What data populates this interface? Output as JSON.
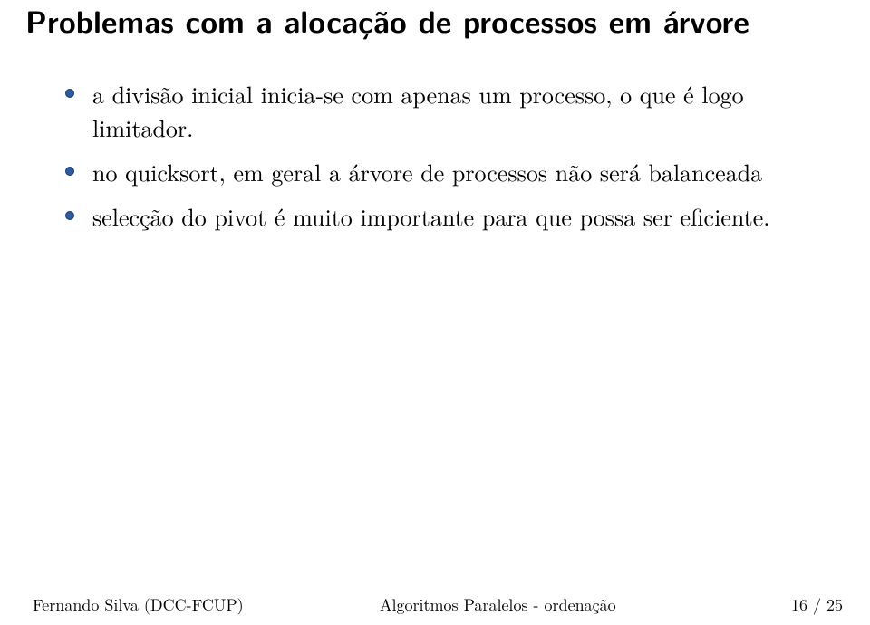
{
  "title": "Problemas com a alocação de processos em árvore",
  "bullets": [
    "a divisão inicial inicia-se com apenas um processo, o que é logo limitador.",
    "no quicksort, em geral a árvore de processos não será balanceada",
    "selecção do pivot é muito importante para que possa ser eficiente."
  ],
  "footer": {
    "author": "Fernando Silva (DCC-FCUP)",
    "subject": "Algoritmos Paralelos - ordenação",
    "page": "16 / 25"
  }
}
